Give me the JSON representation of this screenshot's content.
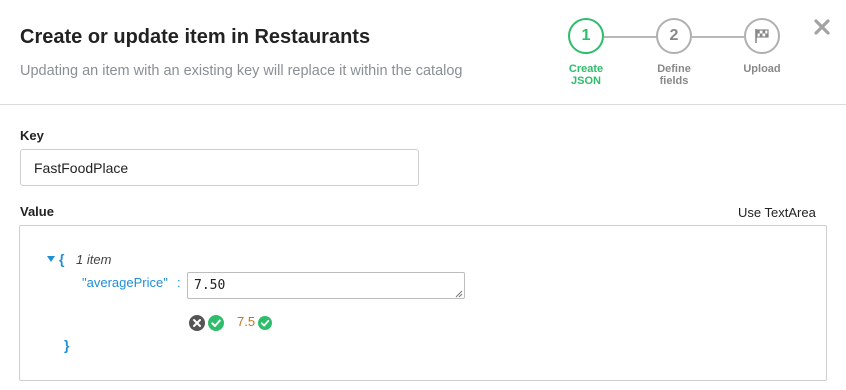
{
  "header": {
    "title": "Create or update item in Restaurants",
    "subtitle": "Updating an item with an existing key will replace it within the catalog"
  },
  "stepper": {
    "steps": [
      {
        "number": "1",
        "label_line1": "Create",
        "label_line2": "JSON",
        "state": "active"
      },
      {
        "number": "2",
        "label_line1": "Define",
        "label_line2": "fields",
        "state": "inactive"
      },
      {
        "icon": "checkered-flag-icon",
        "label_line1": "Upload",
        "label_line2": "",
        "state": "inactive"
      }
    ]
  },
  "form": {
    "key_label": "Key",
    "key_value": "FastFoodPlace",
    "value_label": "Value",
    "use_textarea_label": "Use TextArea"
  },
  "json_editor": {
    "open_brace": "{",
    "close_brace": "}",
    "item_count": "1 item",
    "property_key": "\"averagePrice\"",
    "colon": ":",
    "property_input_value": "7.50",
    "parsed_value": "7.5"
  },
  "colors": {
    "accent_green": "#2ebd6b",
    "json_key_blue": "#1f8fd6",
    "parsed_value_orange": "#c8741e",
    "muted_gray": "#8a8f94"
  }
}
